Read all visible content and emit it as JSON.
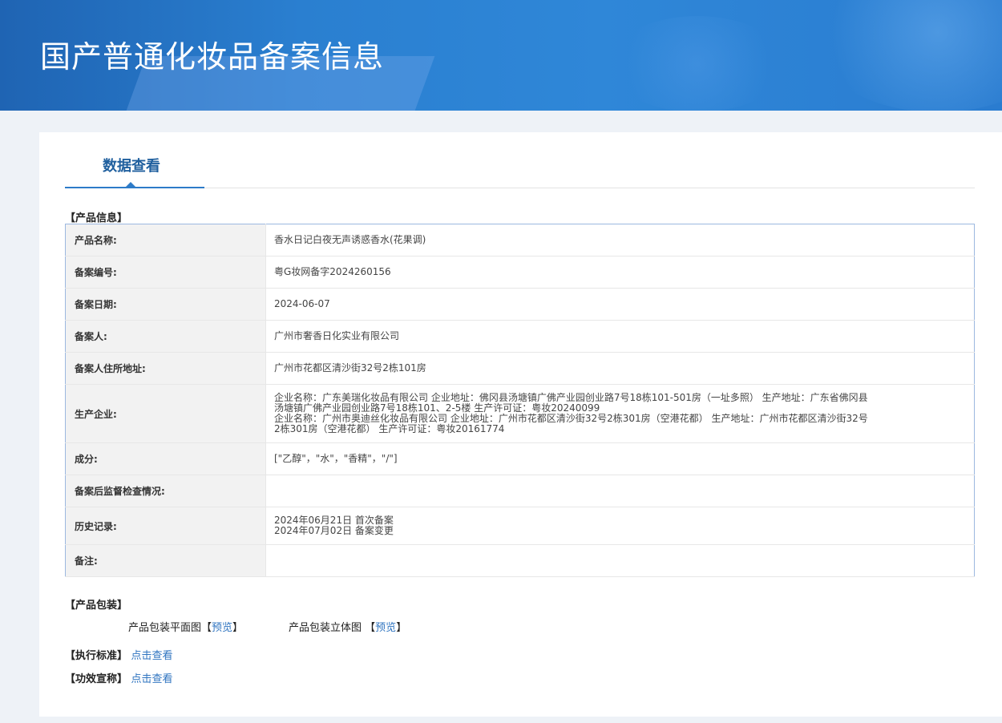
{
  "banner": {
    "title": "国产普通化妆品备案信息"
  },
  "tabs": [
    {
      "label": "数据查看"
    }
  ],
  "product_section": {
    "title": "【产品信息】",
    "rows": {
      "name": {
        "label": "产品名称:",
        "value": "香水日记白夜无声诱惑香水(花果调)"
      },
      "record_no": {
        "label": "备案编号:",
        "value": "粤G妆网备字2024260156"
      },
      "record_date": {
        "label": "备案日期:",
        "value": "2024-06-07"
      },
      "filer": {
        "label": "备案人:",
        "value": "广州市奢香日化实业有限公司"
      },
      "filer_address": {
        "label": "备案人住所地址:",
        "value": "广州市花都区清沙街32号2栋101房"
      },
      "manufacturer": {
        "label": "生产企业:",
        "lines": [
          "企业名称：广东美瑞化妆品有限公司 企业地址：佛冈县汤塘镇广佛产业园创业路7号18栋101-501房（一址多照） 生产地址：广东省佛冈县",
          "汤塘镇广佛产业园创业路7号18栋101、2-5楼 生产许可证：粤妆20240099",
          "企业名称：广州市奥迪丝化妆品有限公司 企业地址：广州市花都区清沙街32号2栋301房（空港花都） 生产地址：广州市花都区清沙街32号",
          "2栋301房（空港花都） 生产许可证：粤妆20161774"
        ]
      },
      "ingredients": {
        "label": "成分:",
        "value": "[\"乙醇\"，\"水\"，\"香精\"，\"/\"]"
      },
      "supervision": {
        "label": "备案后监督检查情况:",
        "value": ""
      },
      "history": {
        "label": "历史记录:",
        "lines": [
          "2024年06月21日 首次备案",
          "2024年07月02日 备案变更"
        ]
      },
      "remarks": {
        "label": "备注:",
        "value": ""
      }
    }
  },
  "packaging_section": {
    "title": "【产品包装】",
    "flat": {
      "label": "产品包装平面图",
      "preview": "预览",
      "open": "【",
      "close": "】"
    },
    "solid": {
      "label": "产品包装立体图",
      "preview": "预览",
      "open": "【",
      "close": "】"
    }
  },
  "standard_section": {
    "title": "【执行标准】",
    "link": "点击查看"
  },
  "efficacy_section": {
    "title": "【功效宣称】",
    "link": "点击查看"
  }
}
